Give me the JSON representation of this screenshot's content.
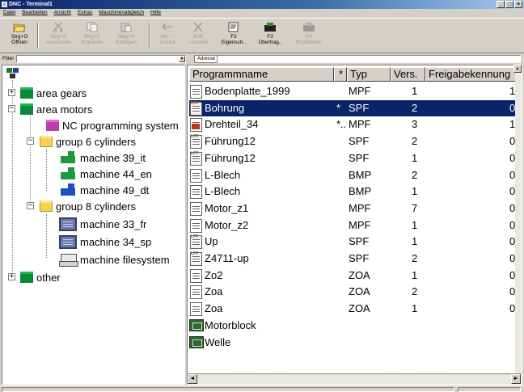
{
  "window": {
    "title": "DNC - Terminal1",
    "controls": [
      "_",
      "□",
      "×"
    ]
  },
  "menu": [
    "Datei",
    "Bearbeiten",
    "Ansicht",
    "Extras",
    "Maschinenabgleich",
    "Hilfe"
  ],
  "toolbar": {
    "buttons": [
      {
        "label1": "Strg+O",
        "label2": "Öffnen",
        "icon": "open-folder-icon",
        "enabled": true
      },
      {
        "label1": "Strg+X",
        "label2": "Ausschnei",
        "icon": "cut-icon",
        "enabled": false
      },
      {
        "label1": "Strg+C",
        "label2": "Kopieren",
        "icon": "copy-icon",
        "enabled": false
      },
      {
        "label1": "Strg+V",
        "label2": "Einfügen",
        "icon": "paste-icon",
        "enabled": false
      },
      {
        "label1": "Alt+←",
        "label2": "Zurück",
        "icon": "back-arrow-icon",
        "enabled": false
      },
      {
        "label1": "Entf",
        "label2": "Löschen",
        "icon": "delete-icon",
        "enabled": false
      },
      {
        "label1": "F2",
        "label2": "Eigensch..",
        "icon": "properties-icon",
        "enabled": true
      },
      {
        "label1": "F3",
        "label2": "Übertrag..",
        "icon": "transfer-icon",
        "enabled": true
      },
      {
        "label1": "F4",
        "label2": "Rückübertr.",
        "icon": "return-transfer-icon",
        "enabled": false
      }
    ]
  },
  "filter": {
    "label": "Filter",
    "value": ""
  },
  "address": {
    "label": "Adresse",
    "value": ""
  },
  "tree": {
    "nodes": [
      {
        "label": "area gears",
        "expander": "+",
        "icon": "green-folder-icon"
      },
      {
        "label": "area motors",
        "expander": "−",
        "icon": "green-folder-icon"
      },
      {
        "label": "NC programming system",
        "icon": "purple-folder-icon"
      },
      {
        "label": "group 6 cylinders",
        "expander": "−",
        "icon": "yellow-folder-icon"
      },
      {
        "label": "machine 39_it",
        "icon": "green-machine-icon"
      },
      {
        "label": "machine 44_en",
        "icon": "green-machine-icon"
      },
      {
        "label": "machine 49_dt",
        "icon": "blue-machine-icon"
      },
      {
        "label": "group 8 cylinders",
        "expander": "−",
        "icon": "yellow-folder-icon"
      },
      {
        "label": "machine 33_fr",
        "icon": "screen-icon"
      },
      {
        "label": "machine 34_sp",
        "icon": "screen-icon"
      },
      {
        "label": "machine filesystem",
        "icon": "filesystem-icon"
      },
      {
        "label": "other",
        "expander": "+",
        "icon": "green-folder-icon"
      }
    ]
  },
  "list": {
    "columns": [
      "Programmname",
      "*",
      "Typ",
      "Vers.",
      "Freigabekennung"
    ],
    "rows": [
      {
        "name": "Bodenplatte_1999",
        "flag": "",
        "type": "MPF",
        "version": "1",
        "release": "1",
        "icon": "document-icon"
      },
      {
        "name": "Bohrung",
        "flag": "*",
        "type": "SPF",
        "version": "2",
        "release": "0",
        "icon": "program-file-icon"
      },
      {
        "name": "Drehteil_34",
        "flag": "*..",
        "type": "MPF",
        "version": "3",
        "release": "1",
        "icon": "drilling-file-icon"
      },
      {
        "name": "Führung12",
        "flag": "",
        "type": "SPF",
        "version": "2",
        "release": "0",
        "icon": "program-file-icon"
      },
      {
        "name": "Führung12",
        "flag": "",
        "type": "SPF",
        "version": "1",
        "release": "0",
        "icon": "program-file-icon"
      },
      {
        "name": "L-Blech",
        "flag": "",
        "type": "BMP",
        "version": "2",
        "release": "0",
        "icon": "document-icon"
      },
      {
        "name": "L-Blech",
        "flag": "",
        "type": "BMP",
        "version": "1",
        "release": "0",
        "icon": "document-icon"
      },
      {
        "name": "Motor_z1",
        "flag": "",
        "type": "MPF",
        "version": "7",
        "release": "0",
        "icon": "document-icon"
      },
      {
        "name": "Motor_z2",
        "flag": "",
        "type": "MPF",
        "version": "1",
        "release": "0",
        "icon": "document-icon"
      },
      {
        "name": "Up",
        "flag": "",
        "type": "SPF",
        "version": "1",
        "release": "0",
        "icon": "program-file-icon"
      },
      {
        "name": "Z4711-up",
        "flag": "",
        "type": "SPF",
        "version": "2",
        "release": "0",
        "icon": "program-file-icon"
      },
      {
        "name": "Zo2",
        "flag": "",
        "type": "ZOA",
        "version": "1",
        "release": "0",
        "icon": "document-icon"
      },
      {
        "name": "Zoa",
        "flag": "",
        "type": "ZOA",
        "version": "2",
        "release": "0",
        "icon": "document-icon"
      },
      {
        "name": "Zoa",
        "flag": "",
        "type": "ZOA",
        "version": "1",
        "release": "0",
        "icon": "document-icon"
      },
      {
        "name": "Motorblock",
        "flag": "",
        "type": "",
        "version": "",
        "release": "",
        "icon": "block-folder-icon"
      },
      {
        "name": "Welle",
        "flag": "",
        "type": "",
        "version": "",
        "release": "",
        "icon": "block-folder-icon"
      }
    ],
    "selected_index": 1
  },
  "colors": {
    "selection": "#0a246a",
    "title_bar": "#0a246a",
    "folder_green": "#0a8a38"
  }
}
